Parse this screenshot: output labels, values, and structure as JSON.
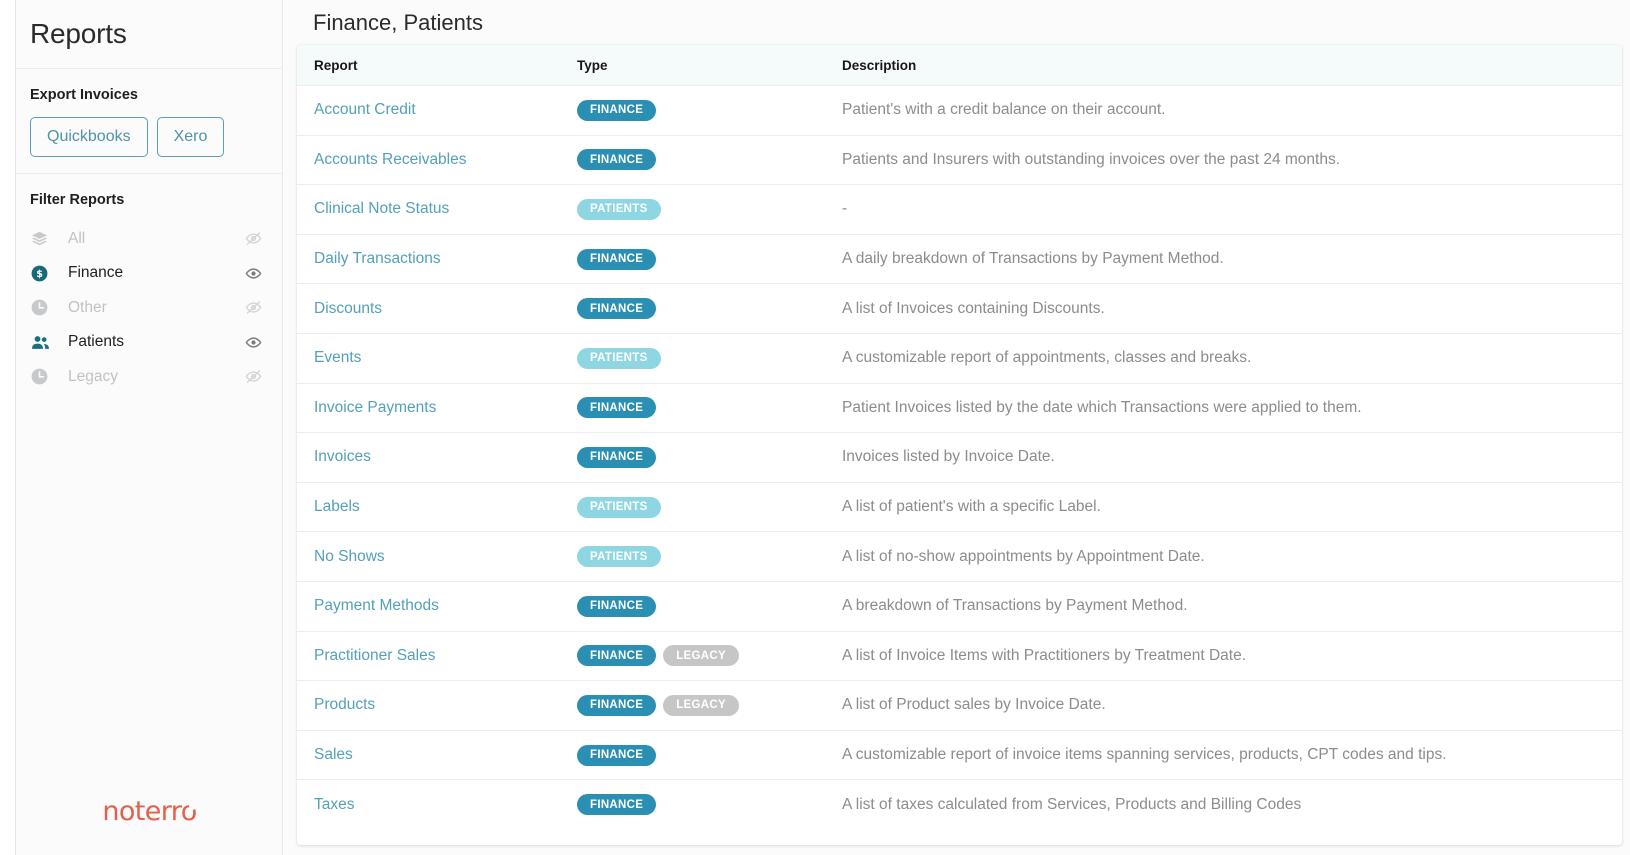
{
  "sidebar": {
    "title": "Reports",
    "export_section": {
      "heading": "Export Invoices",
      "buttons": [
        {
          "label": "Quickbooks",
          "name": "quickbooks"
        },
        {
          "label": "Xero",
          "name": "xero"
        }
      ]
    },
    "filter_section": {
      "heading": "Filter Reports",
      "items": [
        {
          "label": "All",
          "icon": "layers-icon",
          "active": false,
          "eye": "eye-off-icon"
        },
        {
          "label": "Finance",
          "icon": "dollar-circle-icon",
          "active": true,
          "eye": "eye-icon"
        },
        {
          "label": "Other",
          "icon": "clock-icon",
          "active": false,
          "eye": "eye-off-icon"
        },
        {
          "label": "Patients",
          "icon": "users-icon",
          "active": true,
          "eye": "eye-icon"
        },
        {
          "label": "Legacy",
          "icon": "clock-icon",
          "active": false,
          "eye": "eye-off-icon"
        }
      ]
    },
    "logo": "noterro"
  },
  "main": {
    "title": "Finance, Patients",
    "table": {
      "columns": [
        "Report",
        "Type",
        "Description"
      ],
      "rows": [
        {
          "report": "Account Credit",
          "types": [
            "FINANCE"
          ],
          "description": "Patient's with a credit balance on their account."
        },
        {
          "report": "Accounts Receivables",
          "types": [
            "FINANCE"
          ],
          "description": "Patients and Insurers with outstanding invoices over the past 24 months."
        },
        {
          "report": "Clinical Note Status",
          "types": [
            "PATIENTS"
          ],
          "description": "-"
        },
        {
          "report": "Daily Transactions",
          "types": [
            "FINANCE"
          ],
          "description": "A daily breakdown of Transactions by Payment Method."
        },
        {
          "report": "Discounts",
          "types": [
            "FINANCE"
          ],
          "description": "A list of Invoices containing Discounts."
        },
        {
          "report": "Events",
          "types": [
            "PATIENTS"
          ],
          "description": "A customizable report of appointments, classes and breaks."
        },
        {
          "report": "Invoice Payments",
          "types": [
            "FINANCE"
          ],
          "description": "Patient Invoices listed by the date which Transactions were applied to them."
        },
        {
          "report": "Invoices",
          "types": [
            "FINANCE"
          ],
          "description": "Invoices listed by Invoice Date."
        },
        {
          "report": "Labels",
          "types": [
            "PATIENTS"
          ],
          "description": "A list of patient's with a specific Label."
        },
        {
          "report": "No Shows",
          "types": [
            "PATIENTS"
          ],
          "description": "A list of no-show appointments by Appointment Date."
        },
        {
          "report": "Payment Methods",
          "types": [
            "FINANCE"
          ],
          "description": "A breakdown of Transactions by Payment Method."
        },
        {
          "report": "Practitioner Sales",
          "types": [
            "FINANCE",
            "LEGACY"
          ],
          "description": "A list of Invoice Items with Practitioners by Treatment Date."
        },
        {
          "report": "Products",
          "types": [
            "FINANCE",
            "LEGACY"
          ],
          "description": "A list of Product sales by Invoice Date."
        },
        {
          "report": "Sales",
          "types": [
            "FINANCE"
          ],
          "description": "A customizable report of invoice items spanning services, products, CPT codes and tips."
        },
        {
          "report": "Taxes",
          "types": [
            "FINANCE"
          ],
          "description": "A list of taxes calculated from Services, Products and Billing Codes"
        }
      ]
    }
  },
  "colors": {
    "finance_badge": "#2a8fb2",
    "patients_badge": "#8fd6e3",
    "legacy_badge": "#c6c6c6",
    "link": "#54a0b8",
    "logo": "#e4604a",
    "icon_active": "#1a6b75",
    "icon_inactive": "#c7c9cb"
  }
}
